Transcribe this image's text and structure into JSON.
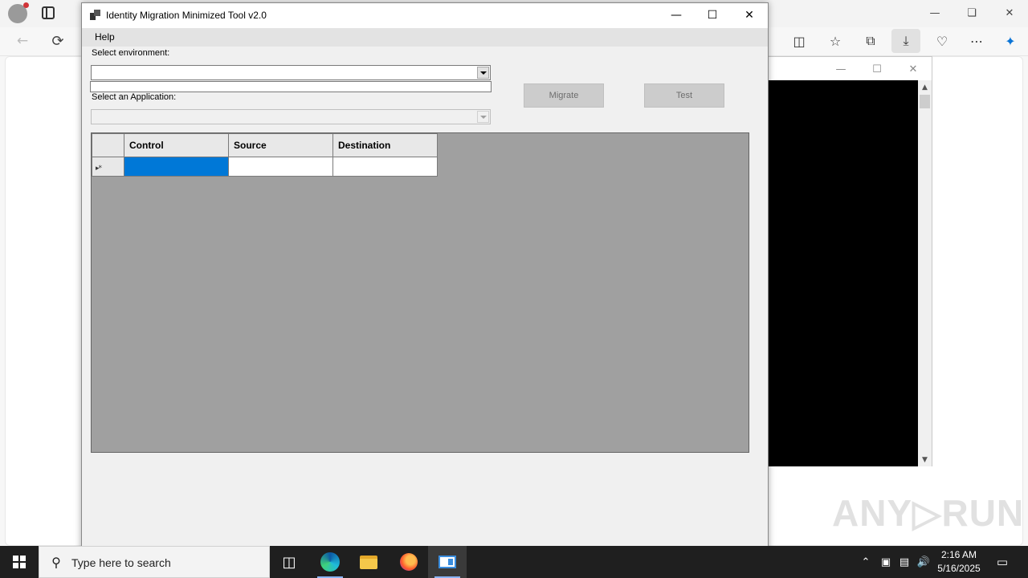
{
  "app": {
    "title": "Identity Migration Minimized Tool v2.0",
    "menu": {
      "help_label": "Help"
    },
    "environment": {
      "label": "Select environment:",
      "selected_value": "",
      "text_value": ""
    },
    "application": {
      "label": "Select an Application:",
      "selected_value": ""
    },
    "buttons": {
      "migrate_label": "Migrate",
      "test_label": "Test"
    },
    "grid": {
      "columns": [
        "Control",
        "Source",
        "Destination"
      ],
      "rows": [
        {
          "control": "",
          "source": "",
          "destination": ""
        }
      ],
      "new_row_marker": "▸*"
    }
  },
  "taskbar": {
    "search_placeholder": "Type here to search",
    "clock_time": "2:16 AM",
    "clock_date": "5/16/2025"
  },
  "watermark": {
    "text": "ANY▷RUN"
  },
  "colors": {
    "selection": "#0078d7",
    "grid_background": "#a0a0a0",
    "form_background": "#f0f0f0",
    "taskbar": "#1f1f1f"
  },
  "icons": [
    "profile-icon",
    "tabs-icon",
    "back-icon",
    "refresh-icon",
    "split-screen-icon",
    "favorites-icon",
    "collections-icon",
    "download-icon",
    "browser-essentials-icon",
    "more-icon",
    "copilot-icon",
    "windows-start-icon",
    "search-icon",
    "task-view-icon",
    "edge-icon",
    "file-explorer-icon",
    "firefox-icon",
    "winforms-app-icon",
    "show-hidden-icons-icon",
    "meet-now-icon",
    "network-icon",
    "volume-icon",
    "notifications-icon"
  ]
}
